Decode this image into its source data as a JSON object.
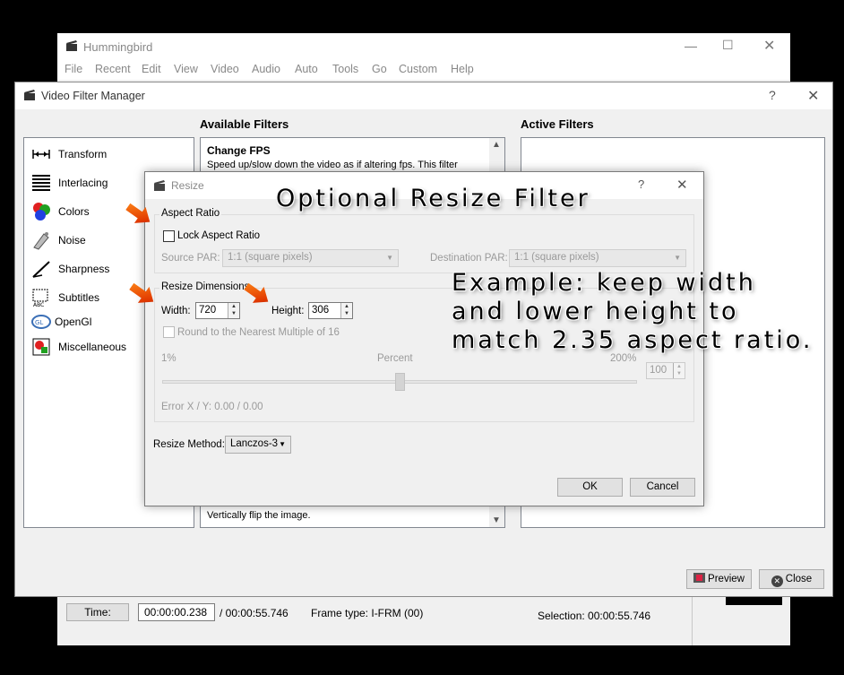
{
  "main_window": {
    "title": "Hummingbird",
    "menu": [
      "File",
      "Recent",
      "Edit",
      "View",
      "Video",
      "Audio",
      "Auto",
      "Tools",
      "Go",
      "Custom",
      "Help"
    ],
    "status": {
      "time_button": "Time:",
      "time_value": "00:00:00.238",
      "duration": "/ 00:00:55.746",
      "frame_type": "Frame type:  I-FRM (00)",
      "selection": "Selection: 00:00:55.746"
    }
  },
  "filter_manager": {
    "title": "Video Filter Manager",
    "help": "?",
    "categories": [
      {
        "label": "Transform",
        "icon": "transform-icon"
      },
      {
        "label": "Interlacing",
        "icon": "interlacing-icon"
      },
      {
        "label": "Colors",
        "icon": "colors-icon"
      },
      {
        "label": "Noise",
        "icon": "noise-icon"
      },
      {
        "label": "Sharpness",
        "icon": "sharpness-icon"
      },
      {
        "label": "Subtitles",
        "icon": "subtitles-icon"
      },
      {
        "label": "OpenGl",
        "icon": "opengl-icon"
      },
      {
        "label": "Miscellaneous",
        "icon": "miscellaneous-icon"
      }
    ],
    "available_heading": "Available Filters",
    "active_heading": "Active Filters",
    "available_first": {
      "name": "Change FPS",
      "desc": "Speed up/slow down the video as if altering fps. This filter"
    },
    "available_last_desc": "Vertically flip the image.",
    "preview_label": "Preview",
    "close_label": "Close"
  },
  "resize_dialog": {
    "title": "Resize",
    "help": "?",
    "aspect_ratio_group": "Aspect Ratio",
    "lock_aspect": "Lock Aspect Ratio",
    "source_par_label": "Source PAR:",
    "source_par_value": "1:1 (square pixels)",
    "dest_par_label": "Destination PAR:",
    "dest_par_value": "1:1 (square pixels)",
    "dimensions_group": "Resize Dimensions",
    "width_label": "Width:",
    "width_value": "720",
    "height_label": "Height:",
    "height_value": "306",
    "round_label": "Round to the Nearest Multiple of 16",
    "percent_min": "1%",
    "percent_label": "Percent",
    "percent_max": "200%",
    "percent_value": "100",
    "percent_slider_fraction": 0.5,
    "error_label": "Error X / Y:  0.00 / 0.00",
    "method_label": "Resize Method:",
    "method_value": "Lanczos-3",
    "ok_label": "OK",
    "cancel_label": "Cancel"
  },
  "annotations": {
    "title": "Optional Resize Filter",
    "note_line1": "Example: keep width",
    "note_line2": "and lower height to",
    "note_line3": "match 2.35 aspect ratio.",
    "arrow_color": "#ff8c1a"
  }
}
